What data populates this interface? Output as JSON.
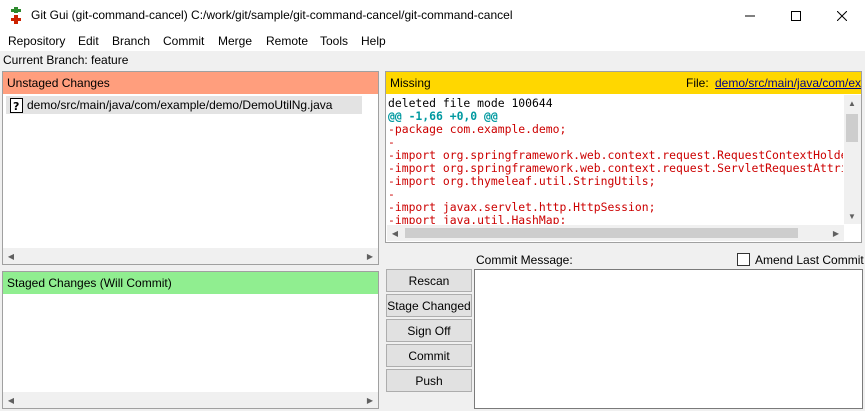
{
  "window": {
    "title": "Git Gui (git-command-cancel) C:/work/git/sample/git-command-cancel/git-command-cancel"
  },
  "menu": [
    {
      "label": "Repository"
    },
    {
      "label": "Edit"
    },
    {
      "label": "Branch"
    },
    {
      "label": "Commit"
    },
    {
      "label": "Merge"
    },
    {
      "label": "Remote"
    },
    {
      "label": "Tools"
    },
    {
      "label": "Help"
    }
  ],
  "current_branch": "Current Branch: feature",
  "unstaged": {
    "header": "Unstaged Changes",
    "files": [
      {
        "path": "demo/src/main/java/com/example/demo/DemoUtilNg.java",
        "icon": "question-mark-file-icon"
      }
    ]
  },
  "staged": {
    "header": "Staged Changes (Will Commit)",
    "files": []
  },
  "diff": {
    "status": "Missing",
    "file_label": "File:",
    "file_path": "demo/src/main/java/com/example/demo/DemoUtilNg.java",
    "lines": [
      {
        "text": "deleted file mode 100644",
        "kind": "hdr"
      },
      {
        "text": "@@ -1,66 +0,0 @@",
        "kind": "hunk"
      },
      {
        "text": "-package com.example.demo;",
        "kind": "del"
      },
      {
        "text": "-",
        "kind": "del"
      },
      {
        "text": "-import org.springframework.web.context.request.RequestContextHolder;",
        "kind": "del"
      },
      {
        "text": "-import org.springframework.web.context.request.ServletRequestAttributes;",
        "kind": "del"
      },
      {
        "text": "-import org.thymeleaf.util.StringUtils;",
        "kind": "del"
      },
      {
        "text": "-",
        "kind": "del"
      },
      {
        "text": "-import javax.servlet.http.HttpSession;",
        "kind": "del"
      },
      {
        "text": "-import java.util.HashMap;",
        "kind": "del"
      }
    ]
  },
  "buttons": {
    "rescan": "Rescan",
    "stage_changed": "Stage Changed",
    "sign_off": "Sign Off",
    "commit": "Commit",
    "push": "Push"
  },
  "commit_message": {
    "label": "Commit Message:",
    "value": "",
    "amend_label": "Amend Last Commit",
    "amend_checked": false
  },
  "colors": {
    "unstaged_header": "#ff9e7d",
    "staged_header": "#90ee90",
    "diff_header": "#ffd700",
    "hunk": "#0099a0",
    "deleted": "#cc0000"
  }
}
